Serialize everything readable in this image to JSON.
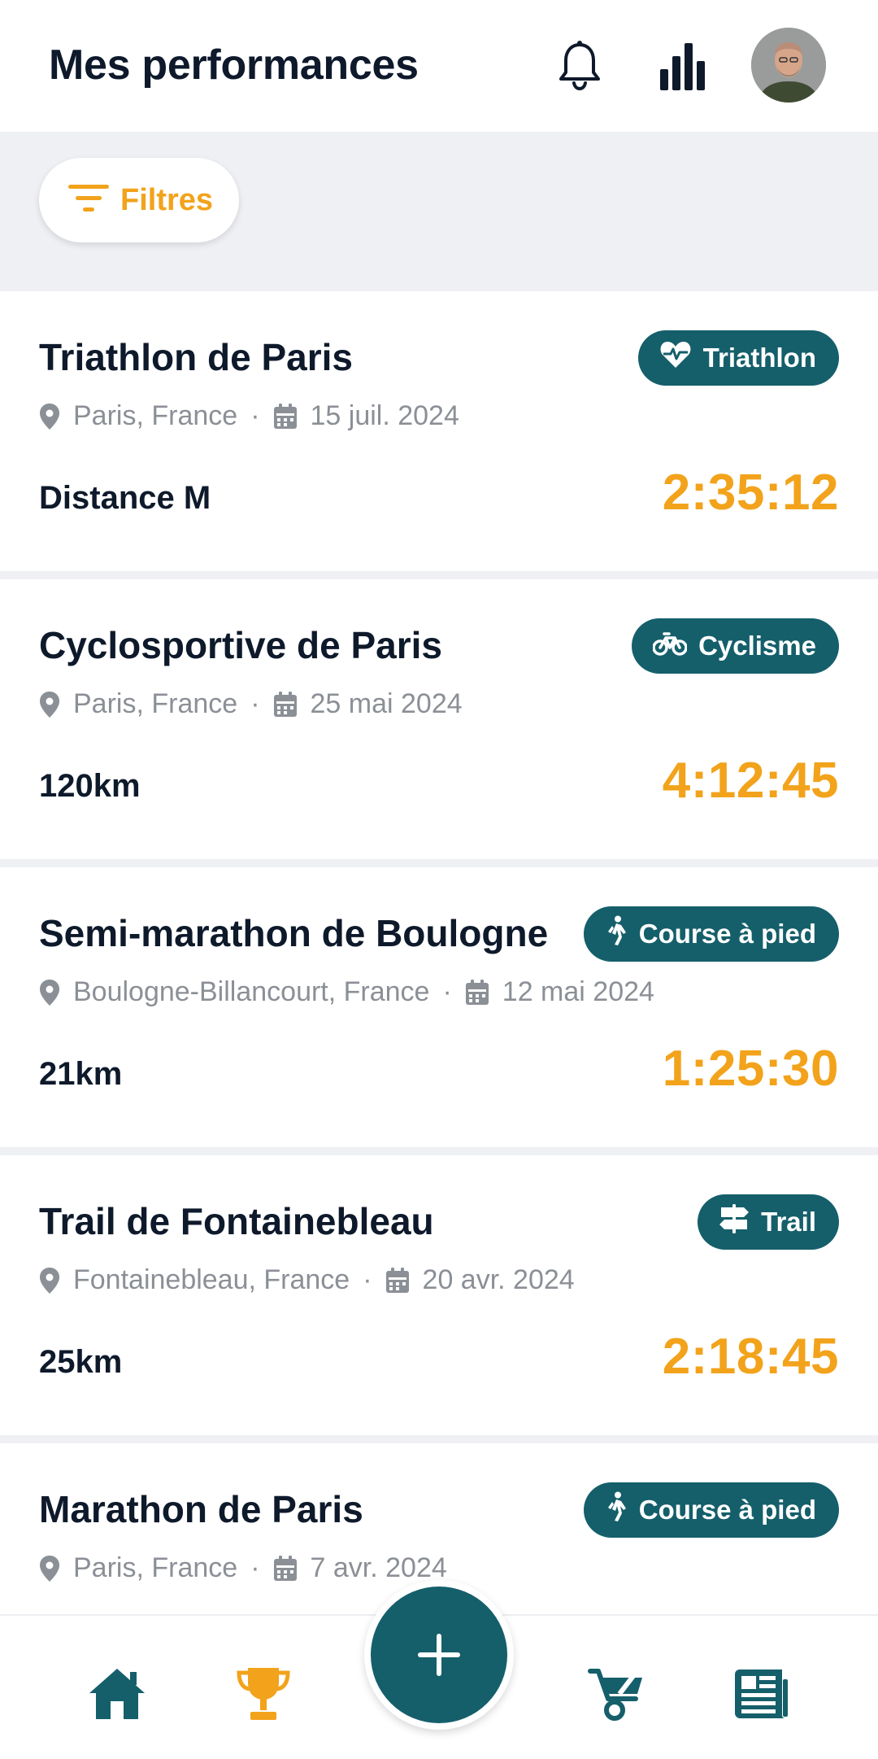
{
  "header": {
    "title": "Mes performances",
    "icons": [
      "bell-icon",
      "bar-chart-icon"
    ],
    "avatar": "user-avatar"
  },
  "filters": {
    "label": "Filtres",
    "icon": "filter-icon"
  },
  "colors": {
    "accent": "#f2a31b",
    "brand": "#155f6b",
    "muted": "#8b8f96",
    "text": "#0e1a2b"
  },
  "events": [
    {
      "title": "Triathlon de Paris",
      "category": "Triathlon",
      "category_icon": "heart-pulse-icon",
      "location": "Paris, France",
      "date": "15 juil. 2024",
      "distance": "Distance M",
      "time": "2:35:12"
    },
    {
      "title": "Cyclosportive de Paris",
      "category": "Cyclisme",
      "category_icon": "bicycle-icon",
      "location": "Paris, France",
      "date": "25 mai 2024",
      "distance": "120km",
      "time": "4:12:45"
    },
    {
      "title": "Semi-marathon de Boulogne",
      "category": "Course à pied",
      "category_icon": "walking-icon",
      "location": "Boulogne-Billancourt, France",
      "date": "12 mai 2024",
      "distance": "21km",
      "time": "1:25:30"
    },
    {
      "title": "Trail de Fontainebleau",
      "category": "Trail",
      "category_icon": "signpost-icon",
      "location": "Fontainebleau, France",
      "date": "20 avr. 2024",
      "distance": "25km",
      "time": "2:18:45"
    },
    {
      "title": "Marathon de Paris",
      "category": "Course à pied",
      "category_icon": "walking-icon",
      "location": "Paris, France",
      "date": "7 avr. 2024",
      "distance": "",
      "time": ""
    }
  ],
  "separator": "·",
  "nav": {
    "items": [
      "home-icon",
      "trophy-icon",
      "add-icon",
      "cart-icon",
      "news-icon"
    ],
    "active": "trophy-icon"
  }
}
